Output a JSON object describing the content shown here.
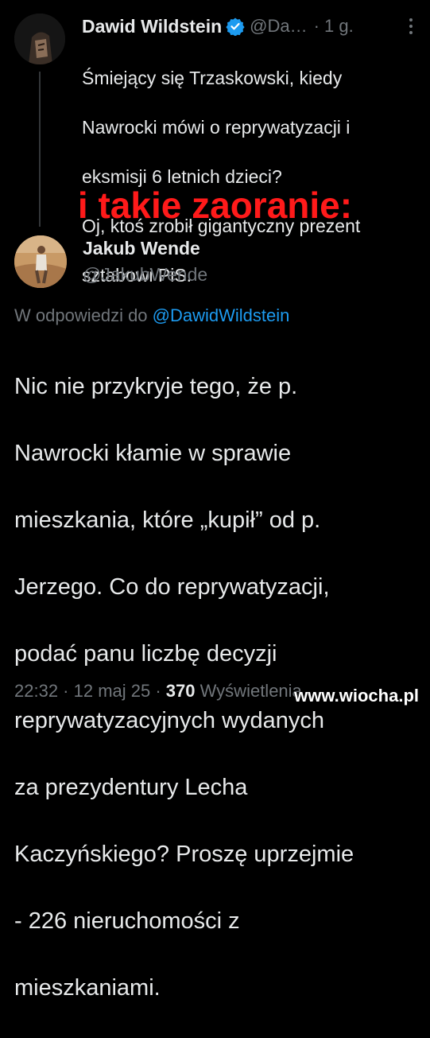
{
  "tweet": {
    "author_name": "Dawid Wildstein",
    "handle": "@Da…",
    "time": "· 1 g.",
    "lines": [
      "Śmiejący się Trzaskowski, kiedy",
      "Nawrocki mówi o reprywatyzacji i",
      "eksmisji 6 letnich dzieci?",
      "Oj, ktoś zrobił gigantyczny prezent",
      "sztabowi PiS."
    ]
  },
  "overlay_caption": "i takie zaoranie:",
  "reply": {
    "author_name": "Jakub Wende",
    "handle": "@JakubWende",
    "reply_prefix": "W odpowiedzi do ",
    "reply_to": "@DawidWildstein",
    "lines": [
      "Nic nie przykryje tego, że p.",
      "Nawrocki kłamie w sprawie",
      "mieszkania, które „kupił” od p.",
      "Jerzego. Co do reprywatyzacji,",
      "podać panu liczbę decyzji",
      "reprywatyzacyjnych wydanych",
      "za prezydentury Lecha",
      "Kaczyńskiego? Proszę uprzejmie",
      "- 226 nieruchomości z",
      "mieszkaniami."
    ],
    "timestamp": "22:32 · 12 maj 25 · ",
    "views_count": "370",
    "views_label": " Wyświetlenia"
  },
  "watermark": "www.wiocha.pl",
  "colors": {
    "background": "#000000",
    "text": "#e7e9ea",
    "muted": "#71767b",
    "link": "#1d9bf0",
    "overlay": "#ff1a1a"
  },
  "icons": [
    "verified-badge-icon",
    "more-options-icon"
  ]
}
